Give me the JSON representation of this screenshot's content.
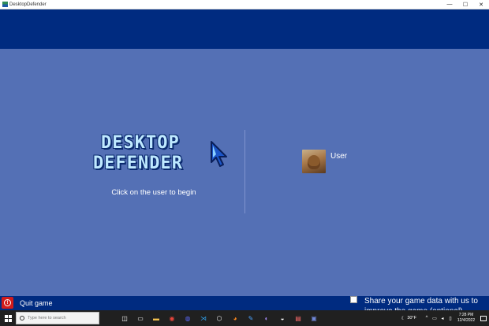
{
  "window": {
    "title": "DesktopDefender",
    "min": "—",
    "max": "☐",
    "close": "✕"
  },
  "logo": {
    "line1": "DESKTOP",
    "line2": "DEFENDER"
  },
  "login": {
    "hint": "Click on the user to begin",
    "user_name": "User"
  },
  "footer": {
    "quit_label": "Quit game",
    "share_label": "Share your game data with us to improve the game (optional)",
    "share_checked": false
  },
  "taskbar": {
    "search_placeholder": "Type here to search",
    "weather": "30°F",
    "time": "7:28 PM",
    "date": "12/4/2022",
    "pinned": [
      {
        "name": "task-view-icon",
        "glyph": "◫",
        "color": "#ffffff"
      },
      {
        "name": "terminal-icon",
        "glyph": "▭",
        "color": "#ffffff"
      },
      {
        "name": "file-explorer-icon",
        "glyph": "▬",
        "color": "#f2c14e"
      },
      {
        "name": "chrome-icon",
        "glyph": "◉",
        "color": "#e8453c"
      },
      {
        "name": "discord-icon",
        "glyph": "◍",
        "color": "#5865f2"
      },
      {
        "name": "vscode-icon",
        "glyph": "⋊",
        "color": "#2f9fea"
      },
      {
        "name": "unity-icon",
        "glyph": "⬡",
        "color": "#ffffff"
      },
      {
        "name": "firefox-icon",
        "glyph": "◕",
        "color": "#ff8a1f"
      },
      {
        "name": "paint-icon",
        "glyph": "✎",
        "color": "#4aa3ff"
      },
      {
        "name": "github-icon",
        "glyph": "◐",
        "color": "#a78bfa"
      },
      {
        "name": "edge-icon",
        "glyph": "◒",
        "color": "#ffffff"
      },
      {
        "name": "app-icon",
        "glyph": "▤",
        "color": "#ff6b6b"
      },
      {
        "name": "game-icon",
        "glyph": "▣",
        "color": "#6f86d6"
      }
    ]
  }
}
